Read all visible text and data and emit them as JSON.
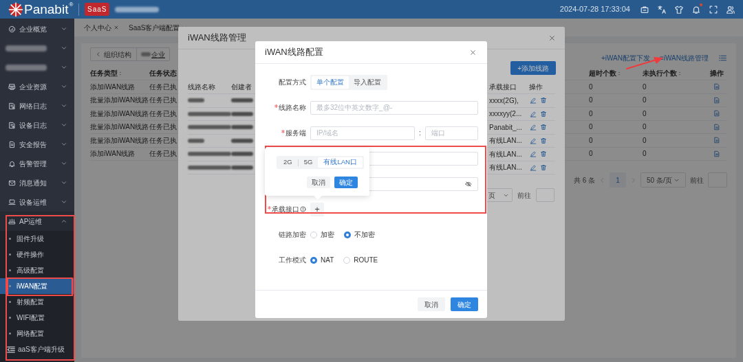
{
  "header": {
    "logo": "Panabit",
    "logo_mark": "®",
    "badge": "SaaS",
    "datetime": "2024-07-28 17:33:04"
  },
  "sidebar": {
    "items": [
      {
        "kind": "menu",
        "label": "企业概览",
        "expanded": false
      },
      {
        "kind": "redacted",
        "expanded": false
      },
      {
        "kind": "redacted",
        "expanded": false
      },
      {
        "kind": "menu",
        "label": "企业资源",
        "expanded": false
      },
      {
        "kind": "menu",
        "label": "网络日志",
        "expanded": false
      },
      {
        "kind": "menu",
        "label": "设备日志",
        "expanded": false
      },
      {
        "kind": "menu",
        "label": "安全报告",
        "expanded": false
      },
      {
        "kind": "menu",
        "label": "告警管理",
        "expanded": false
      },
      {
        "kind": "menu",
        "label": "消息通知",
        "expanded": false
      },
      {
        "kind": "menu",
        "label": "设备运维",
        "expanded": false
      },
      {
        "kind": "menu",
        "label": "AP运维",
        "expanded": true,
        "children": [
          {
            "label": "固件升级",
            "selected": false
          },
          {
            "label": "硬件操作",
            "selected": false
          },
          {
            "label": "高级配置",
            "selected": false
          },
          {
            "label": "iWAN配置",
            "selected": true
          },
          {
            "label": "射频配置",
            "selected": false
          },
          {
            "label": "WIFI配置",
            "selected": false
          },
          {
            "label": "网络配置",
            "selected": false
          },
          {
            "label": "aaS客户端升级",
            "selected": false
          }
        ]
      }
    ]
  },
  "tabs": [
    {
      "label": "个人中心",
      "kind": "closable"
    },
    {
      "label": "SaaS客户端配置",
      "kind": "dropdown"
    }
  ],
  "breadcrumb": {
    "back": "组织结构",
    "current": "企业"
  },
  "task_actions": [
    "+iWAN配置下发",
    "≡iWAN线路管理"
  ],
  "task_table": {
    "columns": [
      "任务类型",
      "任务状态",
      "超时个数",
      "未执行个数",
      "操作"
    ],
    "rows": [
      [
        "添加iWAN线路",
        "任务已执",
        "0",
        "0"
      ],
      [
        "批量添加iWAN线路",
        "任务已执",
        "0",
        "0"
      ],
      [
        "批量添加iWAN线路",
        "任务已执",
        "0",
        "0"
      ],
      [
        "批量添加iWAN线路",
        "任务已执",
        "0",
        "0"
      ],
      [
        "批量添加iWAN线路",
        "任务已执",
        "0",
        "0"
      ],
      [
        "添加iWAN线路",
        "任务已执",
        "0",
        "0"
      ]
    ]
  },
  "task_pagination": {
    "total": "共 6 条",
    "page": "1",
    "page_size": "50 条/页",
    "goto": "前往"
  },
  "line_dialog": {
    "title": "iWAN线路管理",
    "add_button": "+添加线路",
    "columns": [
      "线路名称",
      "创建者",
      "承载接口",
      "操作"
    ],
    "rows": [
      {
        "interface": "xxxx(2G),"
      },
      {
        "interface": "xxxxyy(2..."
      },
      {
        "interface": "Panabit_..."
      },
      {
        "interface": "有线LAN..."
      },
      {
        "interface": "有线LAN..."
      },
      {
        "interface": "有线LAN..."
      }
    ],
    "pagination": {
      "page_size": "页",
      "goto": "前往"
    }
  },
  "config_dialog": {
    "title": "iWAN线路配置",
    "fields": [
      {
        "kind": "segmented",
        "label": "配置方式",
        "required": false,
        "options": [
          {
            "label": "单个配置",
            "selected": true
          },
          {
            "label": "导入配置",
            "selected": false
          }
        ]
      },
      {
        "kind": "input",
        "label": "线路名称",
        "required": true,
        "placeholder": "最多32位中英文数字_@-"
      },
      {
        "kind": "server",
        "label": "服务端",
        "required": true,
        "placeholder": "IP/域名",
        "separator": ":",
        "port_placeholder": "端口"
      },
      {
        "kind": "input",
        "required": false
      },
      {
        "kind": "password",
        "required": false
      },
      {
        "kind": "interface",
        "label": "承载接口",
        "required": true,
        "add": "+"
      },
      {
        "kind": "radio",
        "label": "链路加密",
        "required": false,
        "options": [
          {
            "label": "加密",
            "selected": false
          },
          {
            "label": "不加密",
            "selected": true
          }
        ]
      },
      {
        "kind": "radio",
        "label": "工作模式",
        "required": false,
        "options": [
          {
            "label": "NAT",
            "selected": true
          },
          {
            "label": "ROUTE",
            "selected": false
          }
        ]
      }
    ],
    "popover": {
      "options": [
        {
          "label": "2G",
          "selected": false
        },
        {
          "label": "5G",
          "selected": false
        },
        {
          "label": "有线LAN口",
          "selected": true
        }
      ],
      "cancel": "取消",
      "confirm": "确定"
    },
    "cancel": "取消",
    "confirm": "确定"
  }
}
